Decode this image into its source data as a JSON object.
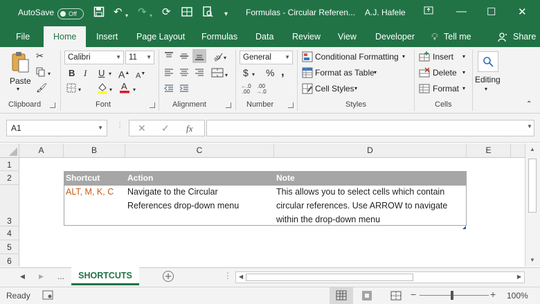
{
  "titlebar": {
    "autosave_label": "AutoSave",
    "autosave_state": "Off",
    "title": "Formulas - Circular Referen...",
    "user": "A.J. Hafele"
  },
  "tabs": [
    "File",
    "Home",
    "Insert",
    "Page Layout",
    "Formulas",
    "Data",
    "Review",
    "View",
    "Developer",
    "Tell me",
    "Share"
  ],
  "ribbon": {
    "clipboard": {
      "paste": "Paste",
      "label": "Clipboard"
    },
    "font": {
      "name": "Calibri",
      "size": "11",
      "label": "Font"
    },
    "alignment": {
      "label": "Alignment"
    },
    "number": {
      "format": "General",
      "label": "Number"
    },
    "styles": {
      "conditional": "Conditional Formatting",
      "table": "Format as Table",
      "cell": "Cell Styles",
      "label": "Styles"
    },
    "cells": {
      "insert": "Insert",
      "delete": "Delete",
      "format": "Format",
      "label": "Cells"
    },
    "editing": {
      "label": "Editing"
    }
  },
  "formula_bar": {
    "name_box": "A1",
    "fx": "fx",
    "formula": ""
  },
  "columns": [
    "A",
    "B",
    "C",
    "D",
    "E"
  ],
  "rows": [
    "1",
    "2",
    "3",
    "4",
    "5",
    "6"
  ],
  "table": {
    "headers": [
      "Shortcut",
      "Action",
      "Note"
    ],
    "row": {
      "shortcut": "ALT, M, K, C",
      "action_lines": [
        "Navigate to the Circular",
        "References drop-down menu"
      ],
      "note_lines": [
        "This allows you to select cells which contain",
        "circular references.  Use ARROW to navigate",
        "within the drop-down menu"
      ]
    }
  },
  "sheetbar": {
    "ellipsis": "...",
    "sheet": "SHORTCUTS"
  },
  "status": {
    "ready": "Ready",
    "zoom": "100%"
  },
  "colors": {
    "brand": "#217346",
    "shortcut_text": "#c55a11",
    "table_header": "#a6a6a6"
  }
}
